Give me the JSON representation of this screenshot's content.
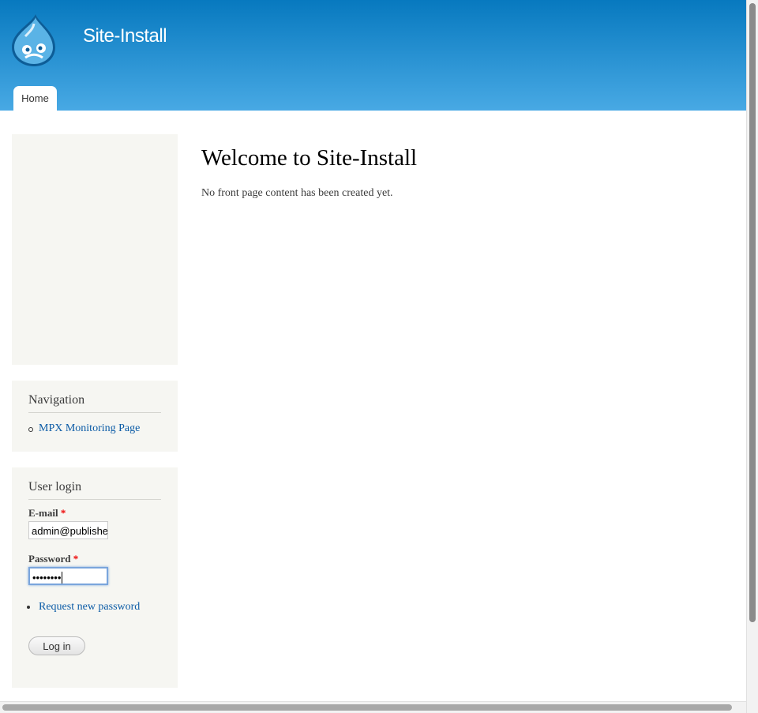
{
  "header": {
    "site_name": "Site-Install",
    "logo_icon": "drupal-drop-logo-icon",
    "tabs": [
      {
        "label": "Home",
        "active": true
      }
    ],
    "colors": {
      "gradient_top": "#0779bf",
      "gradient_bottom": "#48a9e4"
    }
  },
  "sidebar": {
    "navigation": {
      "title": "Navigation",
      "items": [
        {
          "label": "MPX Monitoring Page"
        }
      ]
    },
    "user_login": {
      "title": "User login",
      "email_label": "E-mail",
      "password_label": "Password",
      "required_marker": "*",
      "email_value": "admin@publishe",
      "password_value": "••••••••",
      "request_password_link": "Request new password",
      "login_button": "Log in"
    }
  },
  "main": {
    "title": "Welcome to Site-Install",
    "message": "No front page content has been created yet."
  },
  "colors": {
    "link": "#0b5ba6",
    "sidebar_bg": "#f6f6f2",
    "required": "#ee0000"
  }
}
